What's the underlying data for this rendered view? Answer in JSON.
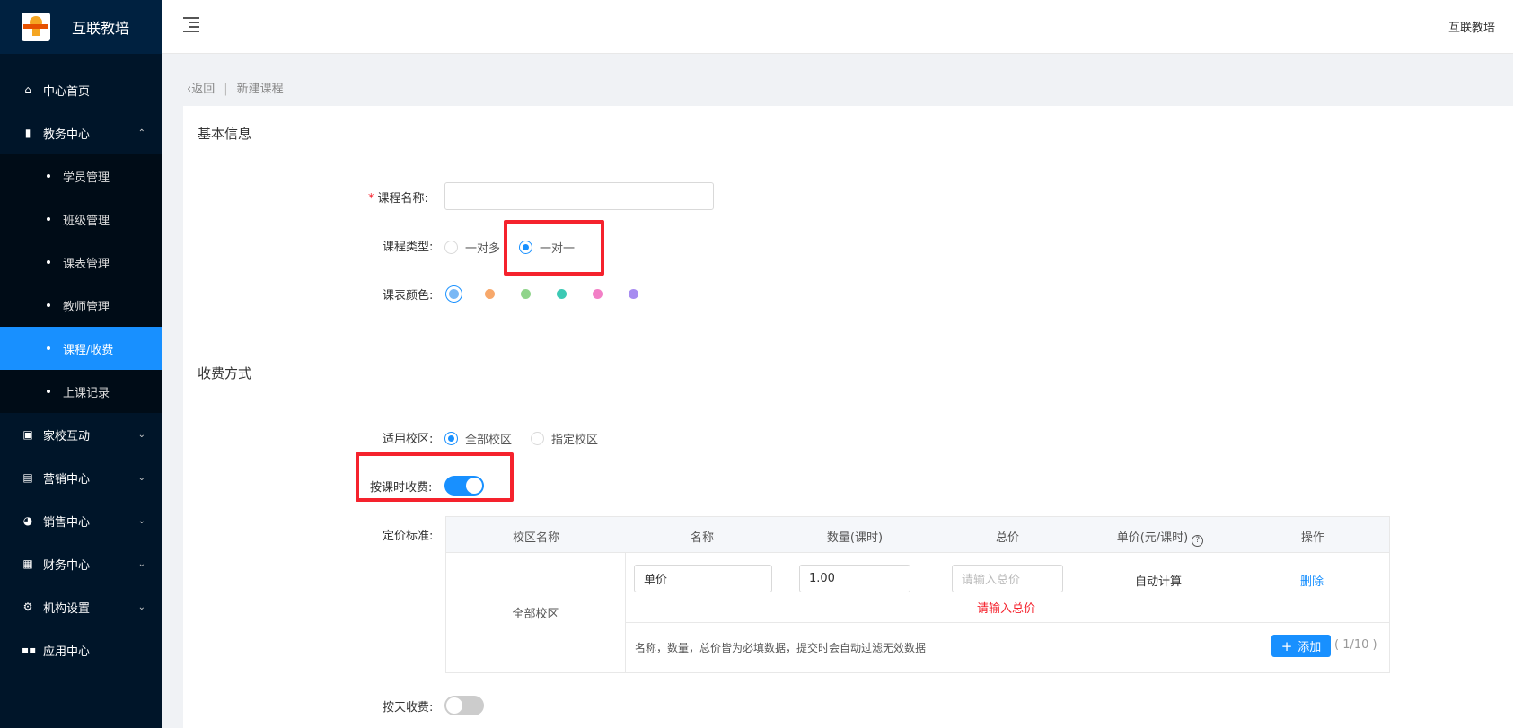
{
  "brand": {
    "name": "互联教培"
  },
  "header": {
    "user": "互联教培"
  },
  "sidebar": {
    "items": [
      {
        "label": "中心首页",
        "icon": "home-icon"
      },
      {
        "label": "教务中心",
        "icon": "book-icon"
      },
      {
        "label": "家校互动",
        "icon": "chat-icon"
      },
      {
        "label": "营销中心",
        "icon": "bag-icon"
      },
      {
        "label": "销售中心",
        "icon": "user-icon"
      },
      {
        "label": "财务中心",
        "icon": "wallet-icon"
      },
      {
        "label": "机构设置",
        "icon": "gear-icon"
      },
      {
        "label": "应用中心",
        "icon": "apps-icon"
      }
    ],
    "sub_items": [
      "学员管理",
      "班级管理",
      "课表管理",
      "教师管理",
      "课程/收费",
      "上课记录"
    ]
  },
  "breadcrumb": {
    "back": "返回",
    "current": "新建课程"
  },
  "basic": {
    "title": "基本信息",
    "course_name_label": "课程名称:",
    "course_name_value": "",
    "course_type_label": "课程类型:",
    "type_options": [
      "一对多",
      "一对一"
    ],
    "type_selected": "一对一",
    "color_label": "课表颜色:",
    "colors": [
      "#7ab8f5",
      "#f7a86b",
      "#8fd48a",
      "#3cc9b4",
      "#f27fc6",
      "#a78cf0"
    ]
  },
  "fee": {
    "title": "收费方式",
    "campus_label": "适用校区:",
    "campus_options": [
      "全部校区",
      "指定校区"
    ],
    "campus_selected": "全部校区",
    "by_lesson_label": "按课时收费:",
    "by_lesson_on": true,
    "pricing_label": "定价标准:",
    "by_day_label": "按天收费:",
    "by_day_on": false
  },
  "table": {
    "headers": [
      "校区名称",
      "名称",
      "数量(课时)",
      "总价",
      "单价(元/课时)",
      "操作"
    ],
    "campus": "全部校区",
    "row": {
      "name": "单价",
      "quantity": "1.00",
      "total_placeholder": "请输入总价",
      "unit_price": "自动计算",
      "action": "删除",
      "error": "请输入总价"
    },
    "note": "名称，数量，总价皆为必填数据，提交时会自动过滤无效数据",
    "add_label": "添加",
    "count": "( 1/10 )"
  }
}
